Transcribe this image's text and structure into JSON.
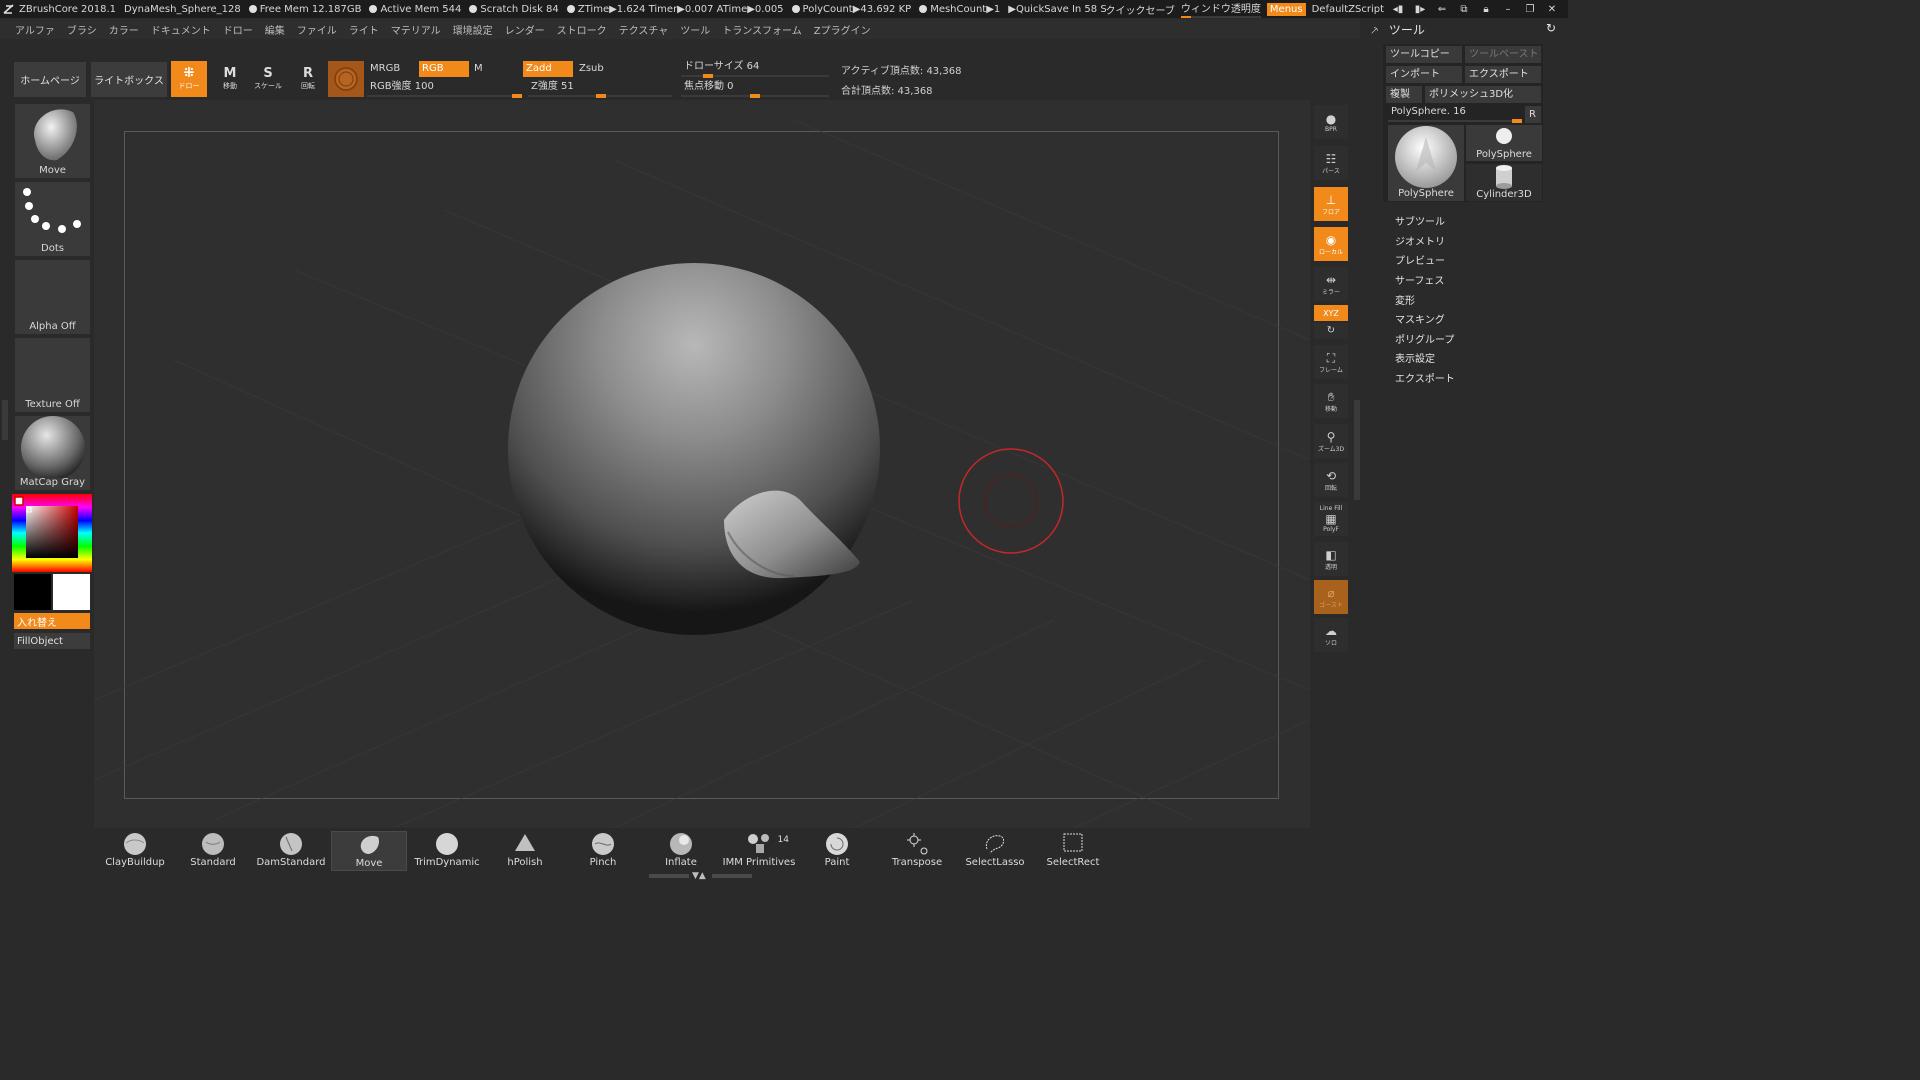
{
  "titlebar": {
    "app": "ZBrushCore 2018.1",
    "document": "DynaMesh_Sphere_128",
    "free_mem": "Free Mem 12.187GB",
    "active_mem": "Active Mem 544",
    "scratch_disk": "Scratch Disk 84",
    "ztime": "ZTime▶1.624 Timer▶0.007 ATime▶0.005",
    "polycount": "PolyCount▶43.692 KP",
    "meshcount": "MeshCount▶1",
    "quicksave": "▶QuickSave In 58 Secs",
    "quick_save_btn": "クイックセーブ",
    "window_transparency": "ウィンドウ透明度",
    "menus": "Menus",
    "default_zscript": "DefaultZScript"
  },
  "menubar": [
    "アルファ",
    "ブラシ",
    "カラー",
    "ドキュメント",
    "ドロー",
    "編集",
    "ファイル",
    "ライト",
    "マテリアル",
    "環境設定",
    "レンダー",
    "ストローク",
    "テクスチャ",
    "ツール",
    "トランスフォーム",
    "Zプラグイン"
  ],
  "topshelf": {
    "home": "ホームページ",
    "lightbox": "ライトボックス",
    "draw": "ドロー",
    "move": "移動",
    "scale": "スケール",
    "rotate": "回転",
    "mrgb": "MRGB",
    "rgb": "RGB",
    "m": "M",
    "zadd": "Zadd",
    "zsub": "Zsub",
    "rgb_intensity_label": "RGB強度 100",
    "z_intensity_label": "Z強度 51",
    "draw_size_label": "ドローサイズ 64",
    "focal_shift_label": "焦点移動 0",
    "active_points": "アクティブ頂点数: 43,368",
    "total_points": "合計頂点数: 43,368",
    "rgb_intensity": 100,
    "z_intensity": 51,
    "draw_size": 64,
    "focal_shift": 0
  },
  "leftpanel": {
    "brush": "Move",
    "stroke": "Dots",
    "alpha": "Alpha Off",
    "texture": "Texture Off",
    "material": "MatCap Gray",
    "swap": "入れ替え",
    "fill": "FillObject"
  },
  "rightcol": {
    "bpr": "BPR",
    "persp": "パース",
    "floor": "フロア",
    "local": "ローカル",
    "symmetry": "ミラー",
    "xyz": "XYZ",
    "frame": "フレーム",
    "move": "移動",
    "zoom3d": "ズーム3D",
    "rotate": "回転",
    "line_fill": "Line Fill",
    "polyf": "PolyF",
    "transp": "透明",
    "ghost": "ゴースト",
    "solo": "ソロ"
  },
  "toolpanel": {
    "title": "ツール",
    "copy": "ツールコピー",
    "paste": "ツールペースト",
    "import": "インポート",
    "export": "エクスポート",
    "clone": "複製",
    "make_polymesh": "ポリメッシュ3D化",
    "current_tool": "PolySphere. 16",
    "r_btn": "R",
    "thumb_main": "PolySphere",
    "thumb_2": "PolySphere",
    "thumb_3": "Cylinder3D",
    "sections": [
      "サブツール",
      "ジオメトリ",
      "プレビュー",
      "サーフェス",
      "変形",
      "マスキング",
      "ポリグループ",
      "表示設定",
      "エクスポート"
    ]
  },
  "brushes": [
    {
      "label": "ClayBuildup"
    },
    {
      "label": "Standard"
    },
    {
      "label": "DamStandard"
    },
    {
      "label": "Move"
    },
    {
      "label": "TrimDynamic"
    },
    {
      "label": "hPolish"
    },
    {
      "label": "Pinch"
    },
    {
      "label": "Inflate"
    },
    {
      "label": "IMM Primitives",
      "count": "14"
    },
    {
      "label": "Paint"
    },
    {
      "label": "Transpose"
    },
    {
      "label": "SelectLasso"
    },
    {
      "label": "SelectRect"
    }
  ],
  "colors": {
    "accent": "#f28a1b",
    "panel": "#2a2a2a",
    "viewport": "#2f2f2f",
    "cursor_ring": "#c62828"
  }
}
